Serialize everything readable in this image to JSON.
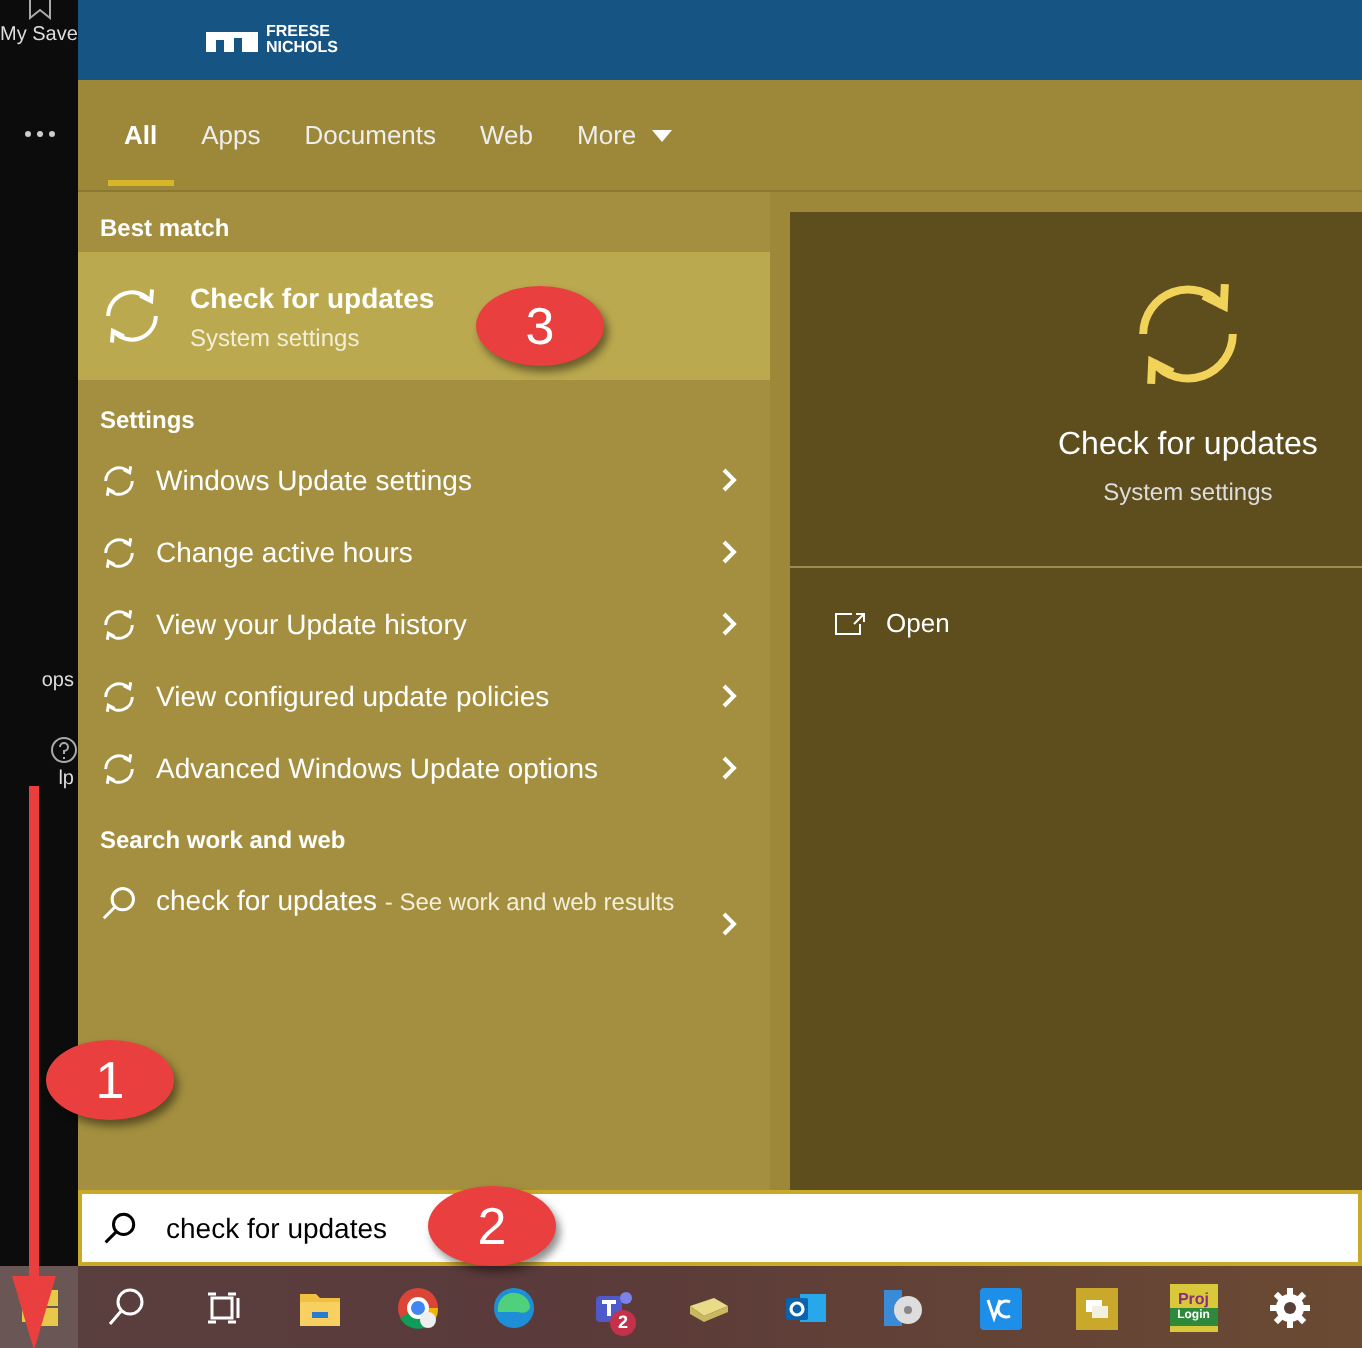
{
  "sidebar": {
    "label": "My Save",
    "apps_label": "ops",
    "help_label": "lp"
  },
  "header": {
    "logo_line1": "FREESE",
    "logo_line2": "NICHOLS"
  },
  "tabs": [
    {
      "label": "All",
      "selected": true,
      "kind": "tab"
    },
    {
      "label": "Apps",
      "selected": false,
      "kind": "tab"
    },
    {
      "label": "Documents",
      "selected": false,
      "kind": "tab"
    },
    {
      "label": "Web",
      "selected": false,
      "kind": "tab"
    },
    {
      "label": "More",
      "selected": false,
      "kind": "dropdown"
    }
  ],
  "best_match": {
    "heading": "Best match",
    "title": "Check for updates",
    "subtitle": "System settings",
    "selected": true
  },
  "settings": {
    "heading": "Settings",
    "items": [
      {
        "label": "Windows Update settings"
      },
      {
        "label": "Change active hours"
      },
      {
        "label": "View your Update history"
      },
      {
        "label": "View configured update policies"
      },
      {
        "label": "Advanced Windows Update options"
      }
    ]
  },
  "web": {
    "heading": "Search work and web",
    "query": "check for updates",
    "hint": "- See work and web results"
  },
  "preview": {
    "title": "Check for updates",
    "subtitle": "System settings",
    "actions": [
      {
        "label": "Open"
      }
    ]
  },
  "search_box": {
    "value": "check for updates"
  },
  "taskbar": {
    "items": [
      {
        "kind": "start"
      },
      {
        "kind": "search"
      },
      {
        "kind": "taskview"
      },
      {
        "kind": "folder"
      },
      {
        "kind": "chrome"
      },
      {
        "kind": "edge"
      },
      {
        "kind": "teams",
        "badge": "2"
      },
      {
        "kind": "notes"
      },
      {
        "kind": "outlook"
      },
      {
        "kind": "disc"
      },
      {
        "kind": "vnc"
      },
      {
        "kind": "yellowapp"
      },
      {
        "kind": "proj",
        "line1": "Proj",
        "line2": "Login"
      },
      {
        "kind": "gear"
      }
    ]
  },
  "callouts": [
    {
      "label": "1"
    },
    {
      "label": "2"
    },
    {
      "label": "3"
    }
  ]
}
